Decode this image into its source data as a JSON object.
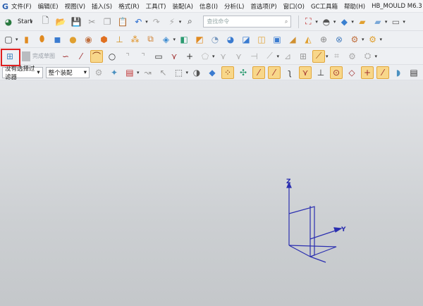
{
  "menu": {
    "items": [
      "文件(F)",
      "编辑(E)",
      "视图(V)",
      "插入(S)",
      "格式(R)",
      "工具(T)",
      "装配(A)",
      "信息(I)",
      "分析(L)",
      "首选项(P)",
      "窗口(O)",
      "GC工具箱",
      "帮助(H)",
      "HB_MOULD M6.3"
    ]
  },
  "toolbar1": {
    "start_label": "Start",
    "search_placeholder": "查找命令",
    "icons_left": [
      {
        "name": "new-file-icon",
        "g": "🗋",
        "c": "#555"
      },
      {
        "name": "open-folder-icon",
        "g": "📂",
        "c": "#d9a520"
      },
      {
        "name": "save-icon",
        "g": "💾",
        "c": "#203a80"
      },
      {
        "name": "cut-icon",
        "g": "✂",
        "c": "#999"
      },
      {
        "name": "copy-icon",
        "g": "❐",
        "c": "#999"
      },
      {
        "name": "paste-icon",
        "g": "📋",
        "c": "#999"
      },
      {
        "name": "undo-icon",
        "g": "↶",
        "c": "#2a6dd0"
      },
      {
        "name": "redo-icon",
        "g": "↷",
        "c": "#aaa"
      },
      {
        "name": "repeat-command-icon",
        "g": "⚡",
        "c": "#aaa"
      },
      {
        "name": "command-finder-icon",
        "g": "⌕",
        "c": "#333"
      }
    ],
    "icons_right": [
      {
        "name": "fit-view-icon",
        "g": "⛶",
        "c": "#c03030"
      },
      {
        "name": "render-style-icon",
        "g": "◓",
        "c": "#555"
      },
      {
        "name": "shaded-cube-icon",
        "g": "◆",
        "c": "#3a80d0"
      },
      {
        "name": "layer-folder-icon",
        "g": "▰",
        "c": "#e0a030"
      },
      {
        "name": "view-folder-icon",
        "g": "▰",
        "c": "#7aa8d8"
      },
      {
        "name": "background-icon",
        "g": "▭",
        "c": "#666"
      }
    ]
  },
  "toolbar2": {
    "icons": [
      {
        "name": "sketch-rectangle-icon",
        "g": "▢",
        "c": "#333"
      },
      {
        "name": "extrude-icon",
        "g": "▮",
        "c": "#e08a20"
      },
      {
        "name": "revolve-icon",
        "g": "⬮",
        "c": "#e08a20"
      },
      {
        "name": "block-icon",
        "g": "◼",
        "c": "#3a7bd0"
      },
      {
        "name": "sphere-icon",
        "g": "●",
        "c": "#e0a030"
      },
      {
        "name": "hole-icon",
        "g": "◉",
        "c": "#c07040"
      },
      {
        "name": "boss-icon",
        "g": "⬢",
        "c": "#e07020"
      },
      {
        "name": "pad-icon",
        "g": "⊥",
        "c": "#d09020"
      },
      {
        "name": "pattern-icon",
        "g": "⁂",
        "c": "#e09020"
      },
      {
        "name": "mirror-icon",
        "g": "⧉",
        "c": "#d08030"
      },
      {
        "name": "combine-icon",
        "g": "◈",
        "c": "#3a8ad0"
      },
      {
        "name": "datum-plane-icon",
        "g": "◧",
        "c": "#2a9a70"
      },
      {
        "name": "trim-body-icon",
        "g": "◩",
        "c": "#e08a20"
      },
      {
        "name": "edge-blend-icon",
        "g": "◔",
        "c": "#7a9ac0"
      },
      {
        "name": "chamfer-icon",
        "g": "◕",
        "c": "#3a7bd0"
      },
      {
        "name": "shell-icon",
        "g": "◪",
        "c": "#3a7bd0"
      },
      {
        "name": "draft-icon",
        "g": "◫",
        "c": "#e0a030"
      },
      {
        "name": "offset-face-icon",
        "g": "▣",
        "c": "#3a7bd0"
      },
      {
        "name": "thicken-icon",
        "g": "◢",
        "c": "#d09030"
      },
      {
        "name": "sew-icon",
        "g": "◭",
        "c": "#e0a030"
      },
      {
        "name": "section-view-icon",
        "g": "⊕",
        "c": "#888"
      },
      {
        "name": "measure-icon",
        "g": "⊗",
        "c": "#4a80c0"
      },
      {
        "name": "assembly-icon",
        "g": "⚙",
        "c": "#c07040"
      },
      {
        "name": "component-icon",
        "g": "⚙",
        "c": "#e0a030"
      }
    ]
  },
  "toolbar3": {
    "finish_sketch_label": "完成草图",
    "icons": [
      {
        "name": "profile-icon",
        "g": "∽",
        "c": "#a03030"
      },
      {
        "name": "line-icon",
        "g": "⁄",
        "c": "#a03030",
        "hl": false
      },
      {
        "name": "arc-icon",
        "g": "⌒",
        "c": "#803010",
        "hl": true
      },
      {
        "name": "circle-icon",
        "g": "○",
        "c": "#333"
      },
      {
        "name": "fillet-icon",
        "g": "⌝",
        "c": "#aaa"
      },
      {
        "name": "chamfer-sketch-icon",
        "g": "⌝",
        "c": "#aaa"
      },
      {
        "name": "rectangle-icon",
        "g": "▭",
        "c": "#333"
      },
      {
        "name": "polygon-icon",
        "g": "⋎",
        "c": "#a03030"
      },
      {
        "name": "point-icon",
        "g": "+",
        "c": "#333"
      },
      {
        "name": "offset-curve-icon",
        "g": "⬠",
        "c": "#bbb"
      },
      {
        "name": "quick-trim-icon",
        "g": "⋎",
        "c": "#aaa"
      },
      {
        "name": "quick-extend-icon",
        "g": "⋎",
        "c": "#aaa"
      },
      {
        "name": "make-corner-icon",
        "g": "⊣",
        "c": "#aaa"
      },
      {
        "name": "constraint-icon",
        "g": "⟋",
        "c": "#aaa"
      },
      {
        "name": "dimension-icon",
        "g": "⊿",
        "c": "#aaa"
      },
      {
        "name": "auto-constraint-icon",
        "g": "⊞",
        "c": "#999"
      },
      {
        "name": "show-constraints-icon",
        "g": "⟋",
        "c": "#a05010",
        "hl": true
      },
      {
        "name": "convert-reference-icon",
        "g": "⌗",
        "c": "#aaa"
      },
      {
        "name": "alternate-solution-icon",
        "g": "⚙",
        "c": "#aaa"
      },
      {
        "name": "relations-icon",
        "g": "⛭",
        "c": "#aaa"
      }
    ]
  },
  "filterbar": {
    "selection_filter": "没有选择过滤器",
    "scope": "整个装配",
    "icons": [
      {
        "name": "filter-settings-icon",
        "g": "⚙",
        "c": "#aaa"
      },
      {
        "name": "select-features-icon",
        "g": "✦",
        "c": "#4a90c0"
      },
      {
        "name": "select-face-icon",
        "g": "▤",
        "c": "#c03030"
      },
      {
        "name": "select-curves-icon",
        "g": "↝",
        "c": "#999"
      },
      {
        "name": "select-edge-icon",
        "g": "↖",
        "c": "#999"
      },
      {
        "name": "rectangle-select-icon",
        "g": "⬚",
        "c": "#555"
      },
      {
        "name": "show-hide-icon",
        "g": "◑",
        "c": "#555"
      },
      {
        "name": "cube-select-icon",
        "g": "◆",
        "c": "#3a7bd0"
      },
      {
        "name": "snap-endpoint-icon",
        "g": "⁘",
        "c": "#803010",
        "hl": true
      },
      {
        "name": "snap-control-icon",
        "g": "✣",
        "c": "#2a9a70"
      },
      {
        "name": "snap-midpoint-icon",
        "g": "⁄",
        "c": "#a03030",
        "hl": true
      },
      {
        "name": "snap-line-icon",
        "g": "⁄",
        "c": "#a03030",
        "hl": true
      },
      {
        "name": "snap-curve-icon",
        "g": "ʅ",
        "c": "#333"
      },
      {
        "name": "snap-intersection-icon",
        "g": "⋎",
        "c": "#a03030",
        "hl": true
      },
      {
        "name": "snap-perpendicular-icon",
        "g": "⊥",
        "c": "#333"
      },
      {
        "name": "snap-center-icon",
        "g": "⊙",
        "c": "#a03030",
        "hl": true
      },
      {
        "name": "snap-quadrant-icon",
        "g": "◇",
        "c": "#a03030"
      },
      {
        "name": "snap-existing-point-icon",
        "g": "+",
        "c": "#a03030",
        "hl": true
      },
      {
        "name": "snap-on-curve-icon",
        "g": "⁄",
        "c": "#a03030",
        "hl": true
      },
      {
        "name": "snap-on-surface-icon",
        "g": "◗",
        "c": "#4a90c0"
      },
      {
        "name": "layer-icon",
        "g": "▤",
        "c": "#333"
      }
    ]
  },
  "viewport": {
    "axis_labels": {
      "z": "Z",
      "y": "Y"
    },
    "triad_color": "#2b2fb0"
  }
}
